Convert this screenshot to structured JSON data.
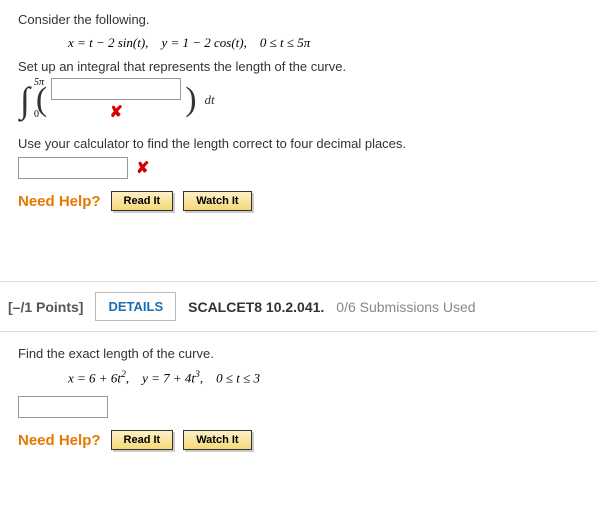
{
  "q1": {
    "prompt1": "Consider the following.",
    "equations": "x = t − 2 sin(t),  y = 1 − 2 cos(t),  0 ≤ t ≤ 5π",
    "prompt2": "Set up an integral that represents the length of the curve.",
    "integral": {
      "upper": "5π",
      "lower": "0",
      "differential": "dt"
    },
    "prompt3": "Use your calculator to find the length correct to four decimal places.",
    "help_label": "Need Help?",
    "read_label": "Read It",
    "watch_label": "Watch It"
  },
  "q2": {
    "points": "[–/1 Points]",
    "details": "DETAILS",
    "source": "SCALCET8 10.2.041.",
    "subs": "0/6 Submissions Used",
    "prompt1": "Find the exact length of the curve.",
    "equations_html": "x = 6 + 6t²,  y = 7 + 4t³,  0 ≤ t ≤ 3",
    "help_label": "Need Help?",
    "read_label": "Read It",
    "watch_label": "Watch It"
  },
  "marks": {
    "wrong": "✘"
  }
}
